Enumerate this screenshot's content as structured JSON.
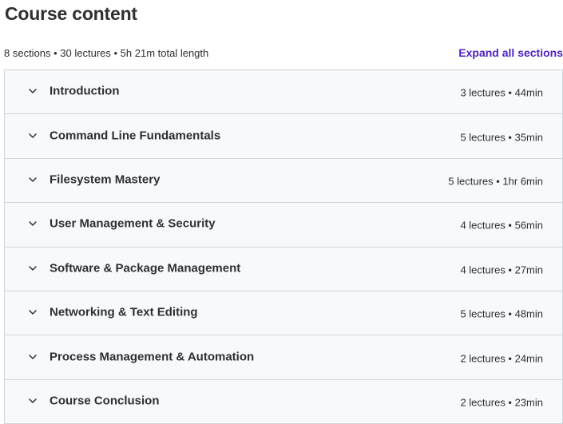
{
  "header": {
    "title": "Course content"
  },
  "summary": {
    "text": "8 sections • 30 lectures • 5h 21m total length",
    "expand_label": "Expand all sections"
  },
  "colors": {
    "link": "#5022c3",
    "section_bg": "#f7f9fa",
    "border": "#d1d7dc",
    "text": "#2d2f31"
  },
  "sections": [
    {
      "title": "Introduction",
      "meta": "3 lectures • 44min",
      "icon": "chevron-down-icon"
    },
    {
      "title": "Command Line Fundamentals",
      "meta": "5 lectures • 35min",
      "icon": "chevron-down-icon"
    },
    {
      "title": "Filesystem Mastery",
      "meta": "5 lectures • 1hr 6min",
      "icon": "chevron-down-icon"
    },
    {
      "title": "User Management & Security",
      "meta": "4 lectures • 56min",
      "icon": "chevron-down-icon"
    },
    {
      "title": "Software & Package Management",
      "meta": "4 lectures • 27min",
      "icon": "chevron-down-icon"
    },
    {
      "title": "Networking & Text Editing",
      "meta": "5 lectures • 48min",
      "icon": "chevron-down-icon"
    },
    {
      "title": "Process Management & Automation",
      "meta": "2 lectures • 24min",
      "icon": "chevron-down-icon"
    },
    {
      "title": "Course Conclusion",
      "meta": "2 lectures • 23min",
      "icon": "chevron-down-icon"
    }
  ]
}
